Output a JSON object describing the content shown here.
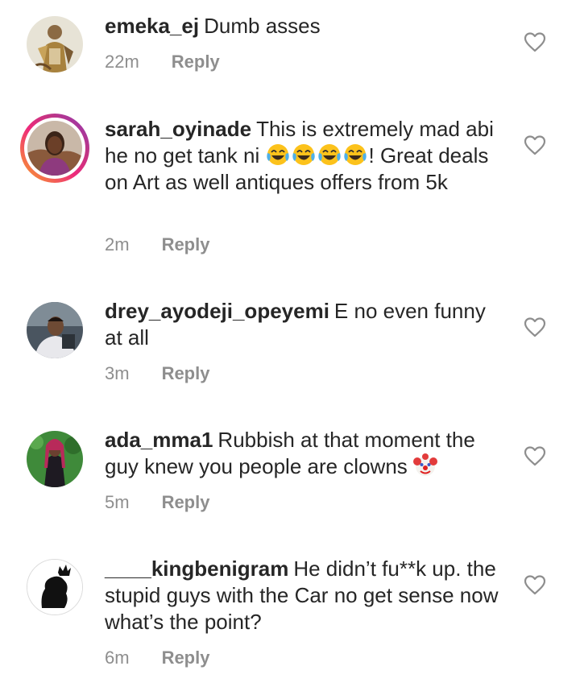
{
  "comments": [
    {
      "username": "emeka_ej",
      "text": "Dumb asses",
      "time": "22m",
      "reply_label": "Reply"
    },
    {
      "username": "sarah_oyinade",
      "text_before": "This is extremely mad abi he no get tank ni",
      "emojis": [
        "face-with-tears-of-joy",
        "face-with-tears-of-joy",
        "face-with-tears-of-joy",
        "face-with-tears-of-joy"
      ],
      "text_after": "! Great deals on Art as well antiques offers from 5k",
      "time": "2m",
      "reply_label": "Reply"
    },
    {
      "username": "drey_ayodeji_opeyemi",
      "text": "E no even funny at all",
      "time": "3m",
      "reply_label": "Reply"
    },
    {
      "username": "ada_mma1",
      "text": "Rubbish at that moment the guy knew you people are clowns",
      "emojis": [
        "clown-face"
      ],
      "time": "5m",
      "reply_label": "Reply"
    },
    {
      "username": "____kingbenigram",
      "text": "He didn’t fu**k up. the stupid guys with the Car no get sense now what’s the point?",
      "time": "6m",
      "reply_label": "Reply"
    }
  ],
  "icons": {
    "like": "heart-outline-icon"
  },
  "colors": {
    "text": "#262626",
    "meta": "#8e8e8e",
    "story_ring_start": "#f9a825",
    "story_ring_end": "#8a3ab9"
  }
}
